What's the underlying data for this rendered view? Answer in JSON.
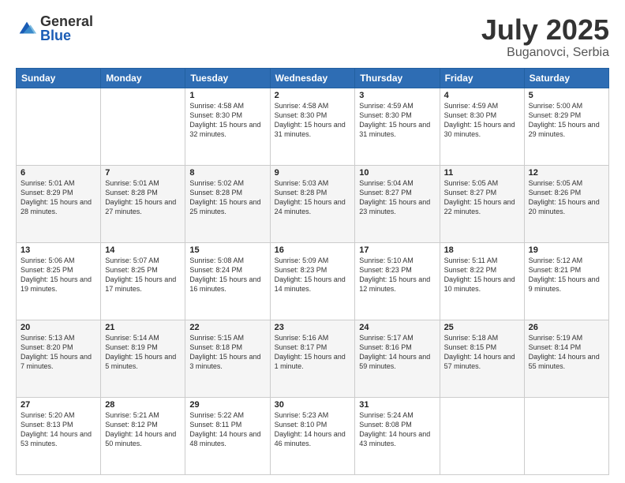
{
  "logo": {
    "general": "General",
    "blue": "Blue"
  },
  "title": {
    "month": "July 2025",
    "location": "Buganovci, Serbia"
  },
  "headers": [
    "Sunday",
    "Monday",
    "Tuesday",
    "Wednesday",
    "Thursday",
    "Friday",
    "Saturday"
  ],
  "weeks": [
    [
      {
        "day": "",
        "sunrise": "",
        "sunset": "",
        "daylight": ""
      },
      {
        "day": "",
        "sunrise": "",
        "sunset": "",
        "daylight": ""
      },
      {
        "day": "1",
        "sunrise": "Sunrise: 4:58 AM",
        "sunset": "Sunset: 8:30 PM",
        "daylight": "Daylight: 15 hours and 32 minutes."
      },
      {
        "day": "2",
        "sunrise": "Sunrise: 4:58 AM",
        "sunset": "Sunset: 8:30 PM",
        "daylight": "Daylight: 15 hours and 31 minutes."
      },
      {
        "day": "3",
        "sunrise": "Sunrise: 4:59 AM",
        "sunset": "Sunset: 8:30 PM",
        "daylight": "Daylight: 15 hours and 31 minutes."
      },
      {
        "day": "4",
        "sunrise": "Sunrise: 4:59 AM",
        "sunset": "Sunset: 8:30 PM",
        "daylight": "Daylight: 15 hours and 30 minutes."
      },
      {
        "day": "5",
        "sunrise": "Sunrise: 5:00 AM",
        "sunset": "Sunset: 8:29 PM",
        "daylight": "Daylight: 15 hours and 29 minutes."
      }
    ],
    [
      {
        "day": "6",
        "sunrise": "Sunrise: 5:01 AM",
        "sunset": "Sunset: 8:29 PM",
        "daylight": "Daylight: 15 hours and 28 minutes."
      },
      {
        "day": "7",
        "sunrise": "Sunrise: 5:01 AM",
        "sunset": "Sunset: 8:28 PM",
        "daylight": "Daylight: 15 hours and 27 minutes."
      },
      {
        "day": "8",
        "sunrise": "Sunrise: 5:02 AM",
        "sunset": "Sunset: 8:28 PM",
        "daylight": "Daylight: 15 hours and 25 minutes."
      },
      {
        "day": "9",
        "sunrise": "Sunrise: 5:03 AM",
        "sunset": "Sunset: 8:28 PM",
        "daylight": "Daylight: 15 hours and 24 minutes."
      },
      {
        "day": "10",
        "sunrise": "Sunrise: 5:04 AM",
        "sunset": "Sunset: 8:27 PM",
        "daylight": "Daylight: 15 hours and 23 minutes."
      },
      {
        "day": "11",
        "sunrise": "Sunrise: 5:05 AM",
        "sunset": "Sunset: 8:27 PM",
        "daylight": "Daylight: 15 hours and 22 minutes."
      },
      {
        "day": "12",
        "sunrise": "Sunrise: 5:05 AM",
        "sunset": "Sunset: 8:26 PM",
        "daylight": "Daylight: 15 hours and 20 minutes."
      }
    ],
    [
      {
        "day": "13",
        "sunrise": "Sunrise: 5:06 AM",
        "sunset": "Sunset: 8:25 PM",
        "daylight": "Daylight: 15 hours and 19 minutes."
      },
      {
        "day": "14",
        "sunrise": "Sunrise: 5:07 AM",
        "sunset": "Sunset: 8:25 PM",
        "daylight": "Daylight: 15 hours and 17 minutes."
      },
      {
        "day": "15",
        "sunrise": "Sunrise: 5:08 AM",
        "sunset": "Sunset: 8:24 PM",
        "daylight": "Daylight: 15 hours and 16 minutes."
      },
      {
        "day": "16",
        "sunrise": "Sunrise: 5:09 AM",
        "sunset": "Sunset: 8:23 PM",
        "daylight": "Daylight: 15 hours and 14 minutes."
      },
      {
        "day": "17",
        "sunrise": "Sunrise: 5:10 AM",
        "sunset": "Sunset: 8:23 PM",
        "daylight": "Daylight: 15 hours and 12 minutes."
      },
      {
        "day": "18",
        "sunrise": "Sunrise: 5:11 AM",
        "sunset": "Sunset: 8:22 PM",
        "daylight": "Daylight: 15 hours and 10 minutes."
      },
      {
        "day": "19",
        "sunrise": "Sunrise: 5:12 AM",
        "sunset": "Sunset: 8:21 PM",
        "daylight": "Daylight: 15 hours and 9 minutes."
      }
    ],
    [
      {
        "day": "20",
        "sunrise": "Sunrise: 5:13 AM",
        "sunset": "Sunset: 8:20 PM",
        "daylight": "Daylight: 15 hours and 7 minutes."
      },
      {
        "day": "21",
        "sunrise": "Sunrise: 5:14 AM",
        "sunset": "Sunset: 8:19 PM",
        "daylight": "Daylight: 15 hours and 5 minutes."
      },
      {
        "day": "22",
        "sunrise": "Sunrise: 5:15 AM",
        "sunset": "Sunset: 8:18 PM",
        "daylight": "Daylight: 15 hours and 3 minutes."
      },
      {
        "day": "23",
        "sunrise": "Sunrise: 5:16 AM",
        "sunset": "Sunset: 8:17 PM",
        "daylight": "Daylight: 15 hours and 1 minute."
      },
      {
        "day": "24",
        "sunrise": "Sunrise: 5:17 AM",
        "sunset": "Sunset: 8:16 PM",
        "daylight": "Daylight: 14 hours and 59 minutes."
      },
      {
        "day": "25",
        "sunrise": "Sunrise: 5:18 AM",
        "sunset": "Sunset: 8:15 PM",
        "daylight": "Daylight: 14 hours and 57 minutes."
      },
      {
        "day": "26",
        "sunrise": "Sunrise: 5:19 AM",
        "sunset": "Sunset: 8:14 PM",
        "daylight": "Daylight: 14 hours and 55 minutes."
      }
    ],
    [
      {
        "day": "27",
        "sunrise": "Sunrise: 5:20 AM",
        "sunset": "Sunset: 8:13 PM",
        "daylight": "Daylight: 14 hours and 53 minutes."
      },
      {
        "day": "28",
        "sunrise": "Sunrise: 5:21 AM",
        "sunset": "Sunset: 8:12 PM",
        "daylight": "Daylight: 14 hours and 50 minutes."
      },
      {
        "day": "29",
        "sunrise": "Sunrise: 5:22 AM",
        "sunset": "Sunset: 8:11 PM",
        "daylight": "Daylight: 14 hours and 48 minutes."
      },
      {
        "day": "30",
        "sunrise": "Sunrise: 5:23 AM",
        "sunset": "Sunset: 8:10 PM",
        "daylight": "Daylight: 14 hours and 46 minutes."
      },
      {
        "day": "31",
        "sunrise": "Sunrise: 5:24 AM",
        "sunset": "Sunset: 8:08 PM",
        "daylight": "Daylight: 14 hours and 43 minutes."
      },
      {
        "day": "",
        "sunrise": "",
        "sunset": "",
        "daylight": ""
      },
      {
        "day": "",
        "sunrise": "",
        "sunset": "",
        "daylight": ""
      }
    ]
  ]
}
